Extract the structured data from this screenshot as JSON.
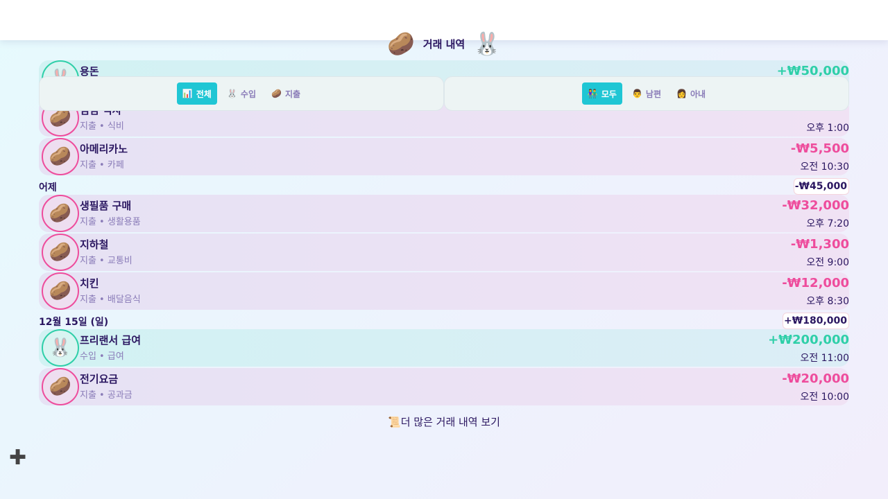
{
  "header": {
    "title": "거래 내역",
    "left_icon": "potato-icon",
    "right_icon": "rabbit-icon"
  },
  "filters": {
    "type": [
      {
        "label": "전체",
        "icon": "📊",
        "active": true
      },
      {
        "label": "수입",
        "icon": "🐰",
        "active": false
      },
      {
        "label": "지출",
        "icon": "🥔",
        "active": false
      }
    ],
    "person": [
      {
        "label": "모두",
        "icon": "👫",
        "active": true
      },
      {
        "label": "남편",
        "icon": "👨",
        "active": false
      },
      {
        "label": "아내",
        "icon": "👩",
        "active": false
      }
    ]
  },
  "groups": [
    {
      "label": "",
      "total": "",
      "items": [
        {
          "type": "inc",
          "name": "용돈",
          "category": "",
          "amount": "+₩50,000",
          "time": ""
        },
        {
          "type": "exp",
          "name": "점심 식사",
          "category": "지출 • 식비",
          "amount": "",
          "time": "오후 1:00"
        },
        {
          "type": "exp",
          "name": "아메리카노",
          "category": "지출 • 카페",
          "amount": "-₩5,500",
          "time": "오전 10:30"
        }
      ]
    },
    {
      "label": "어제",
      "total": "-₩45,000",
      "items": [
        {
          "type": "exp",
          "name": "생필품 구매",
          "category": "지출 • 생활용품",
          "amount": "-₩32,000",
          "time": "오후 7:20"
        },
        {
          "type": "exp",
          "name": "지하철",
          "category": "지출 • 교통비",
          "amount": "-₩1,300",
          "time": "오전 9:00"
        },
        {
          "type": "exp",
          "name": "치킨",
          "category": "지출 • 배달음식",
          "amount": "-₩12,000",
          "time": "오후 8:30"
        }
      ]
    },
    {
      "label": "12월 15일 (일)",
      "total": "+₩180,000",
      "items": [
        {
          "type": "inc",
          "name": "프리랜서 급여",
          "category": "수입 • 급여",
          "amount": "+₩200,000",
          "time": "오전 11:00"
        },
        {
          "type": "exp",
          "name": "전기요금",
          "category": "지출 • 공과금",
          "amount": "-₩20,000",
          "time": "오전 10:00"
        }
      ]
    }
  ],
  "more_link": "더 많은 거래 내역 보기",
  "colors": {
    "income": "#2ecfa8",
    "expense": "#ee4c9c",
    "accent": "#1fc6d4",
    "text": "#2a1660"
  }
}
